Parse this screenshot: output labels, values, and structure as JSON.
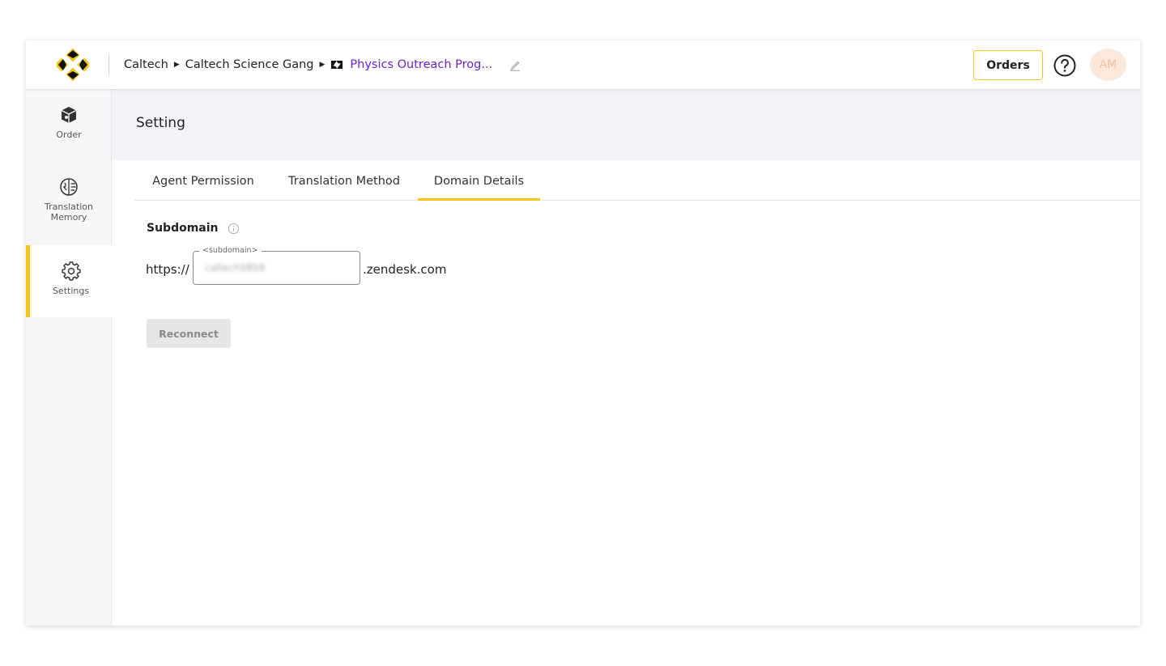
{
  "topbar": {
    "breadcrumb": {
      "org": "Caltech",
      "team": "Caltech Science Gang",
      "project": "Physics Outreach Prog..."
    },
    "orders_label": "Orders",
    "avatar_initials": "AM"
  },
  "sidebar": {
    "items": [
      {
        "label": "Order",
        "icon": "box-icon"
      },
      {
        "label_line1": "Translation",
        "label_line2": "Memory",
        "icon": "brain-icon"
      },
      {
        "label": "Settings",
        "icon": "gear-icon"
      }
    ],
    "active_index": 2
  },
  "page": {
    "title": "Setting"
  },
  "tabs": [
    {
      "label": "Agent Permission"
    },
    {
      "label": "Translation Method"
    },
    {
      "label": "Domain Details"
    }
  ],
  "active_tab": 2,
  "subdomain": {
    "label": "Subdomain",
    "prefix": "https://",
    "field_legend": "<subdomain>",
    "field_value": "caltech5859",
    "suffix": ".zendesk.com"
  },
  "reconnect_label": "Reconnect",
  "colors": {
    "accent": "#f5c518",
    "project_link": "#6a1fd1",
    "header_band": "#f3f4f8"
  }
}
